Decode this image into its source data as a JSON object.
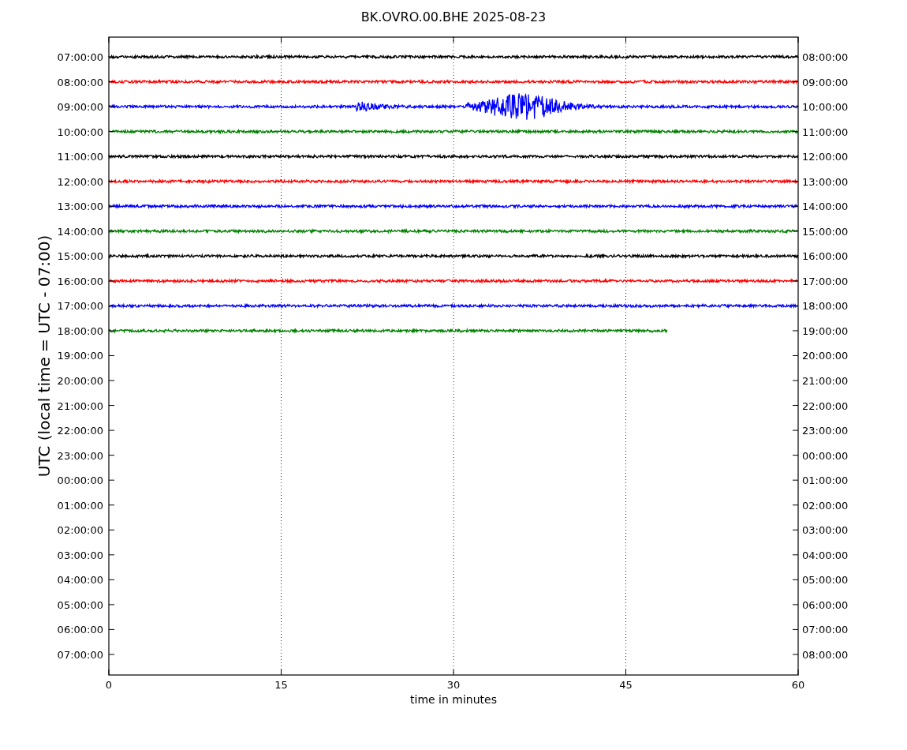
{
  "figure": {
    "title": "BK.OVRO.00.BHE 2025-08-23",
    "ylabel": "UTC (local time = UTC - 07:00)",
    "xlabel": "time in minutes",
    "xticks": [
      "0",
      "15",
      "30",
      "45",
      "60"
    ],
    "rows": [
      {
        "left": "07:00:00",
        "right": "08:00:00"
      },
      {
        "left": "08:00:00",
        "right": "09:00:00"
      },
      {
        "left": "09:00:00",
        "right": "10:00:00"
      },
      {
        "left": "10:00:00",
        "right": "11:00:00"
      },
      {
        "left": "11:00:00",
        "right": "12:00:00"
      },
      {
        "left": "12:00:00",
        "right": "13:00:00"
      },
      {
        "left": "13:00:00",
        "right": "14:00:00"
      },
      {
        "left": "14:00:00",
        "right": "15:00:00"
      },
      {
        "left": "15:00:00",
        "right": "16:00:00"
      },
      {
        "left": "16:00:00",
        "right": "17:00:00"
      },
      {
        "left": "17:00:00",
        "right": "18:00:00"
      },
      {
        "left": "18:00:00",
        "right": "19:00:00"
      },
      {
        "left": "19:00:00",
        "right": "20:00:00"
      },
      {
        "left": "20:00:00",
        "right": "21:00:00"
      },
      {
        "left": "21:00:00",
        "right": "22:00:00"
      },
      {
        "left": "22:00:00",
        "right": "23:00:00"
      },
      {
        "left": "23:00:00",
        "right": "00:00:00"
      },
      {
        "left": "00:00:00",
        "right": "01:00:00"
      },
      {
        "left": "01:00:00",
        "right": "02:00:00"
      },
      {
        "left": "02:00:00",
        "right": "03:00:00"
      },
      {
        "left": "03:00:00",
        "right": "04:00:00"
      },
      {
        "left": "04:00:00",
        "right": "05:00:00"
      },
      {
        "left": "05:00:00",
        "right": "06:00:00"
      },
      {
        "left": "06:00:00",
        "right": "07:00:00"
      },
      {
        "left": "07:00:00",
        "right": "08:00:00"
      }
    ],
    "traces": [
      {
        "color": "#000000",
        "kind": "noise",
        "level": 1
      },
      {
        "color": "#ff0000",
        "kind": "noise",
        "level": 1
      },
      {
        "color": "#0000ff",
        "kind": "quake",
        "level": 1
      },
      {
        "color": "#008000",
        "kind": "noise",
        "level": 1
      },
      {
        "color": "#000000",
        "kind": "noise",
        "level": 1
      },
      {
        "color": "#ff0000",
        "kind": "noise",
        "level": 1
      },
      {
        "color": "#0000ff",
        "kind": "noise",
        "level": 1
      },
      {
        "color": "#008000",
        "kind": "noise",
        "level": 1
      },
      {
        "color": "#000000",
        "kind": "noise",
        "level": 1
      },
      {
        "color": "#ff0000",
        "kind": "noise",
        "level": 1
      },
      {
        "color": "#0000ff",
        "kind": "noise",
        "level": 1
      },
      {
        "color": "#008000",
        "kind": "noise",
        "level": 0.81
      }
    ]
  }
}
